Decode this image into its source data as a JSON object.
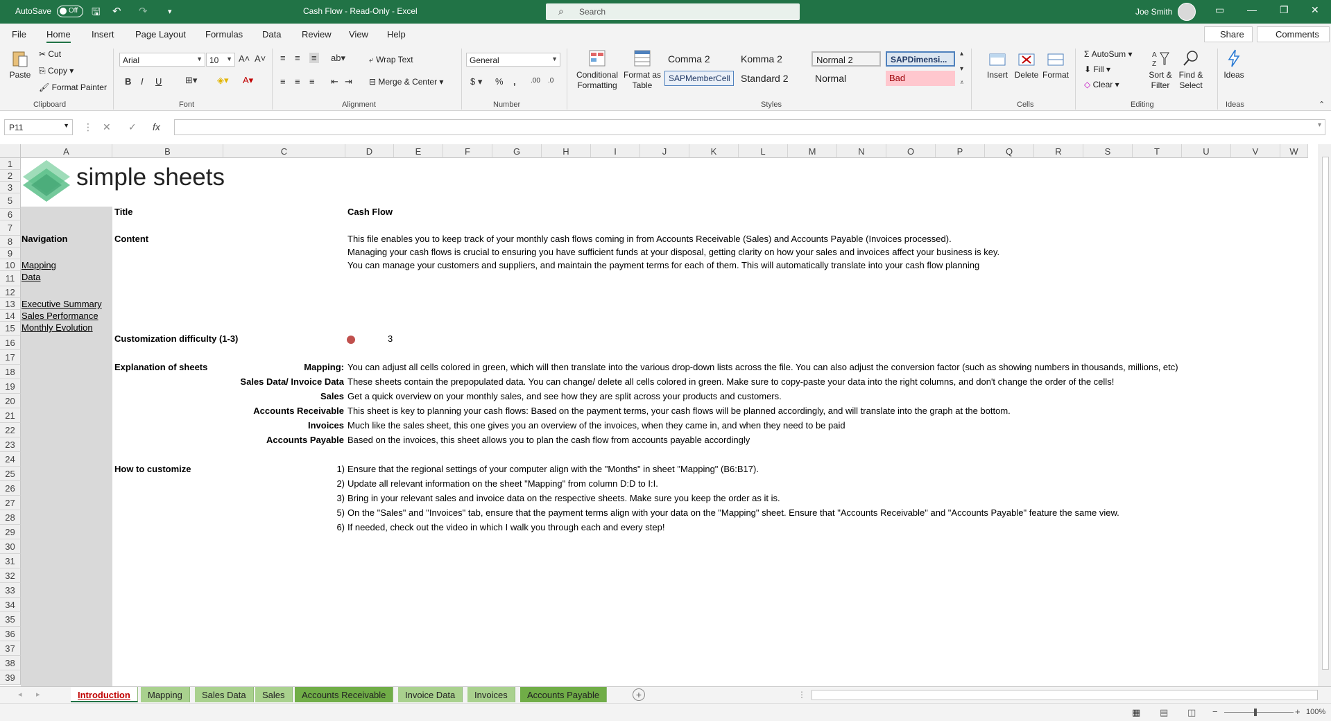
{
  "app": {
    "autosave_label": "AutoSave",
    "autosave_state": "Off",
    "title": "Cash Flow  -  Read-Only  -  Excel",
    "search_placeholder": "Search",
    "user": "Joe Smith"
  },
  "menu": {
    "tabs": [
      "File",
      "Home",
      "Insert",
      "Page Layout",
      "Formulas",
      "Data",
      "Review",
      "View",
      "Help"
    ],
    "active": "Home",
    "share": "Share",
    "comments": "Comments"
  },
  "ribbon": {
    "clipboard": {
      "paste": "Paste",
      "cut": "Cut",
      "copy": "Copy",
      "format_painter": "Format Painter",
      "label": "Clipboard"
    },
    "font": {
      "family": "Arial",
      "size": "10",
      "label": "Font",
      "bold": "B",
      "italic": "I",
      "underline": "U"
    },
    "alignment": {
      "wrap_text": "Wrap Text",
      "merge_center": "Merge & Center",
      "label": "Alignment"
    },
    "number": {
      "format": "General",
      "label": "Number"
    },
    "styles": {
      "conditional_formatting": "Conditional Formatting",
      "format_as_table": "Format as Table",
      "cells": [
        "Comma 2",
        "Komma 2",
        "Normal 2",
        "SAPDimensi...",
        "SAPMemberCell",
        "Standard 2",
        "Normal",
        "Bad"
      ],
      "label": "Styles"
    },
    "cells": {
      "insert": "Insert",
      "delete": "Delete",
      "format": "Format",
      "label": "Cells"
    },
    "editing": {
      "autosum": "AutoSum",
      "fill": "Fill",
      "clear": "Clear",
      "sort_filter": "Sort & Filter",
      "find_select": "Find & Select",
      "label": "Editing"
    },
    "ideas": {
      "ideas": "Ideas",
      "label": "Ideas"
    }
  },
  "formula_bar": {
    "name_box": "P11",
    "fx": "fx",
    "formula": ""
  },
  "grid": {
    "columns": [
      "A",
      "B",
      "C",
      "D",
      "E",
      "F",
      "G",
      "H",
      "I",
      "J",
      "K",
      "L",
      "M",
      "N",
      "O",
      "P",
      "Q",
      "R",
      "S",
      "T",
      "U",
      "V",
      "W"
    ],
    "rows": [
      "1",
      "2",
      "3",
      "5",
      "6",
      "7",
      "8",
      "9",
      "10",
      "11",
      "12",
      "13",
      "14",
      "15",
      "16",
      "17",
      "18",
      "19",
      "20",
      "21",
      "22",
      "23",
      "24",
      "25",
      "26",
      "27",
      "28",
      "29",
      "30",
      "31",
      "32",
      "33",
      "34",
      "35",
      "36",
      "37",
      "38",
      "39"
    ],
    "logo_text": "simple sheets",
    "title_label": "Title",
    "title_value": "Cash Flow",
    "navigation_label": "Navigation",
    "nav_links": [
      "Mapping",
      "Data",
      "Executive Summary",
      "Sales Performance",
      "Monthly Evolution"
    ],
    "content_label": "Content",
    "content_lines": [
      "This file enables you to keep track of your monthly cash flows coming in from Accounts Receivable (Sales) and Accounts Payable (Invoices processed).",
      "Managing your cash flows is crucial to ensuring you have sufficient funds at your disposal, getting clarity on how your sales and invoices affect your business is key.",
      "You can manage your customers and suppliers, and maintain the payment terms for each of them. This will automatically translate into your cash flow planning"
    ],
    "difficulty_label": "Customization difficulty (1-3)",
    "difficulty_value": "3",
    "difficulty_color": "#c0504d",
    "explanation_label": "Explanation of sheets",
    "explanations": [
      {
        "name": "Mapping:",
        "text": "You can adjust all cells colored in green, which will then translate into the various drop-down lists across the file. You can also adjust the conversion factor (such as showing numbers in thousands, millions, etc)"
      },
      {
        "name": "Sales Data/ Invoice Data",
        "text": "These sheets contain the prepopulated data. You can change/ delete all cells colored in green. Make sure to copy-paste your data into the right columns, and don't change the order of the cells!"
      },
      {
        "name": "Sales",
        "text": "Get a quick overview on your monthly sales, and see how they are split across your products and customers."
      },
      {
        "name": "Accounts Receivable",
        "text": "This sheet is key to planning your cash flows: Based on the payment terms, your cash flows will be planned accordingly, and will translate into the graph at the bottom."
      },
      {
        "name": "Invoices",
        "text": "Much like the sales sheet, this one gives you an overview of the invoices, when they came in, and when they need to be paid"
      },
      {
        "name": "Accounts Payable",
        "text": "Based on the invoices, this sheet allows you to plan the cash flow from accounts payable accordingly"
      }
    ],
    "howto_label": "How to customize",
    "howto": [
      {
        "num": "1)",
        "text": "Ensure that the regional settings of your computer align with the \"Months\" in sheet \"Mapping\" (B6:B17)."
      },
      {
        "num": "2)",
        "text": "Update all relevant information on the sheet \"Mapping\" from column D:D to I:I."
      },
      {
        "num": "3)",
        "text": "Bring in your relevant sales and invoice data on the respective sheets. Make sure you keep the order as it is."
      },
      {
        "num": "5)",
        "text": "On the \"Sales\" and \"Invoices\" tab, ensure that the payment terms align with your data on the \"Mapping\" sheet. Ensure that \"Accounts Receivable\" and \"Accounts Payable\" feature the same view."
      },
      {
        "num": "6)",
        "text": "If needed, check out the video in which I walk you through each and every step!"
      }
    ]
  },
  "sheets": [
    "Introduction",
    "Mapping",
    "Sales Data",
    "Sales",
    "Accounts Receivable",
    "Invoice Data",
    "Invoices",
    "Accounts Payable"
  ],
  "active_sheet": "Introduction",
  "status": {
    "zoom": "100%"
  }
}
